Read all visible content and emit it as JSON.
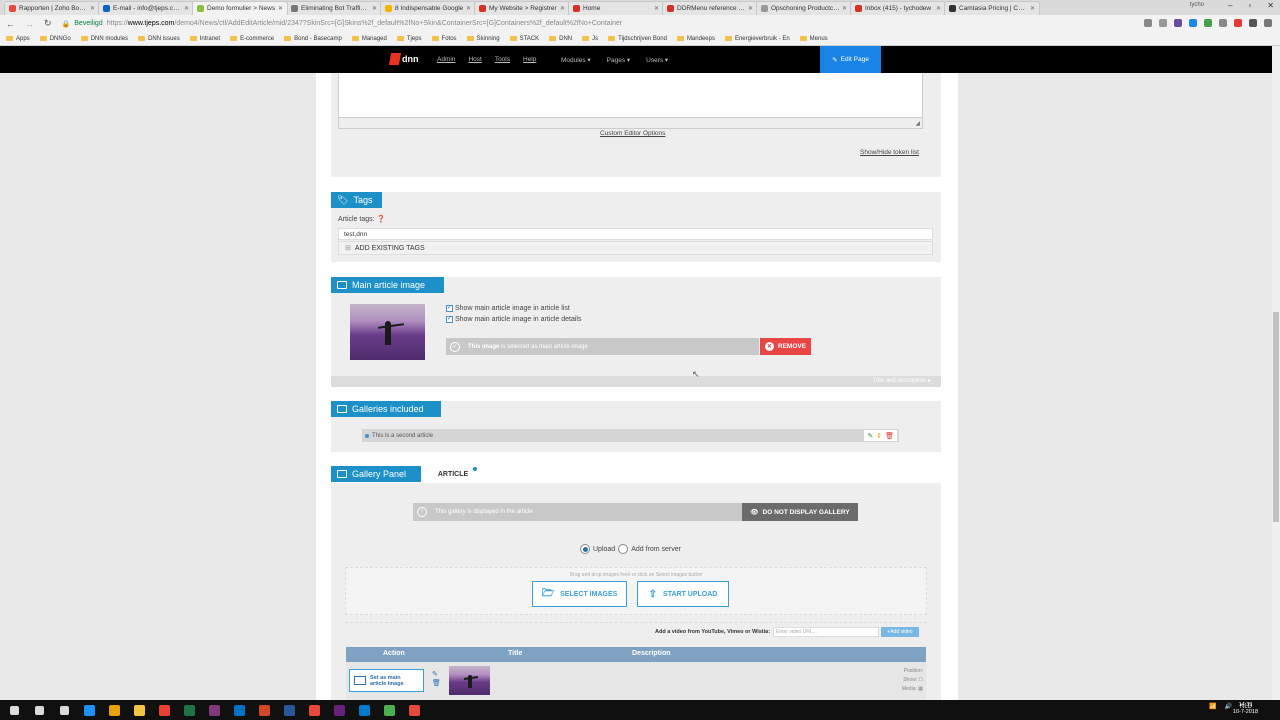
{
  "browser": {
    "tabs": [
      {
        "label": "Rapporten | Zoho Books",
        "color": "#e8483a"
      },
      {
        "label": "E-mail - info@tjeps.com",
        "color": "#0a64c8"
      },
      {
        "label": "Demo formulier > News",
        "color": "#8cbf3f",
        "active": true
      },
      {
        "label": "Eliminating Bot Traffic fro",
        "color": "#777777"
      },
      {
        "label": "8 Indispensable Google",
        "color": "#f4b400"
      },
      {
        "label": "My Website > Registrer",
        "color": "#d93025"
      },
      {
        "label": "Home",
        "color": "#d93025"
      },
      {
        "label": "DDRMenu reference guid",
        "color": "#d93025"
      },
      {
        "label": "Opschoning Productcode",
        "color": "#999999"
      },
      {
        "label": "Inbox (415) - tychodew",
        "color": "#d93025"
      },
      {
        "label": "Camtasia Pricing | Camt",
        "color": "#333333"
      }
    ],
    "user": "tycho",
    "secure_label": "Beveiligd",
    "url_prefix": "https://",
    "url_host": "www.tjeps.com",
    "url_path": "/demo4/News/ctl/AddEditArticle/mid/2347?SkinSrc=[G]Skins%2f_default%2fNo+Skin&ContainerSrc=[G]Containers%2f_default%2fNo+Container"
  },
  "bookmarks": [
    "Apps",
    "DNNGo",
    "DNN modules",
    "DNN issues",
    "Intranet",
    "E-commerce",
    "Bond - Basecamp",
    "Managed",
    "Tjeps",
    "Fotos",
    "Skinning",
    "STACK",
    "DNN",
    "Js",
    "Tijdschrijven Bond",
    "Mandeeps",
    "Energieverbruik - En",
    "Menus"
  ],
  "dnn_bar": {
    "logo": "dnn",
    "links": [
      "Admin",
      "Host",
      "Tools",
      "Help"
    ],
    "menus": [
      "Modules ▾",
      "Pages ▾",
      "Users ▾"
    ],
    "edit_page": "Edit Page"
  },
  "editor": {
    "custom_options": "Custom Editor Options",
    "token_list": "Show/Hide token list"
  },
  "tags": {
    "title": "Tags",
    "label": "Article tags:",
    "value": "test,dnn",
    "add_existing": "ADD EXISTING TAGS"
  },
  "main_image": {
    "title": "Main article image",
    "check_list": "Show main article image in article list",
    "check_details": "Show main article image in article details",
    "notice_strong": "This image",
    "notice_rest": "is selected as main article image",
    "remove": "REMOVE",
    "title_desc": "Title and description"
  },
  "galleries": {
    "title": "Galleries included",
    "item": "This is a second article"
  },
  "gallery_panel": {
    "title": "Gallery Panel",
    "tab": "ARTICLE",
    "notice": "This gallery is displayed in the article",
    "no_display": "DO NOT DISPLAY GALLERY",
    "radio_upload": "Upload",
    "radio_server": "Add from server",
    "drop_hint": "Drag and drop images here or click on Select images button",
    "select_images": "SELECT IMAGES",
    "start_upload": "START UPLOAD",
    "video_label": "Add a video from YouTube, Vimeo or Wistia:",
    "video_placeholder": "Enter video URL...",
    "video_button": "Add video",
    "table_headers": [
      "Action",
      "Title",
      "Description"
    ],
    "set_main_line1": "Set as main",
    "set_main_line2": "article image",
    "row_meta": [
      "Position:",
      "Show:",
      "Media:"
    ]
  },
  "taskbar": {
    "icons": [
      "#ffffff",
      "#ffffff",
      "#ffffff",
      "#1e90ff",
      "#e8a200",
      "#f4c542",
      "#e94235",
      "#217346",
      "#80397b",
      "#0072c6",
      "#d24726",
      "#2b579a",
      "#e8483a",
      "#68217a",
      "#007acc",
      "#4caf50",
      "#e8483a"
    ],
    "lang": "NLD",
    "time": "14:33",
    "date": "10-7-2018"
  }
}
